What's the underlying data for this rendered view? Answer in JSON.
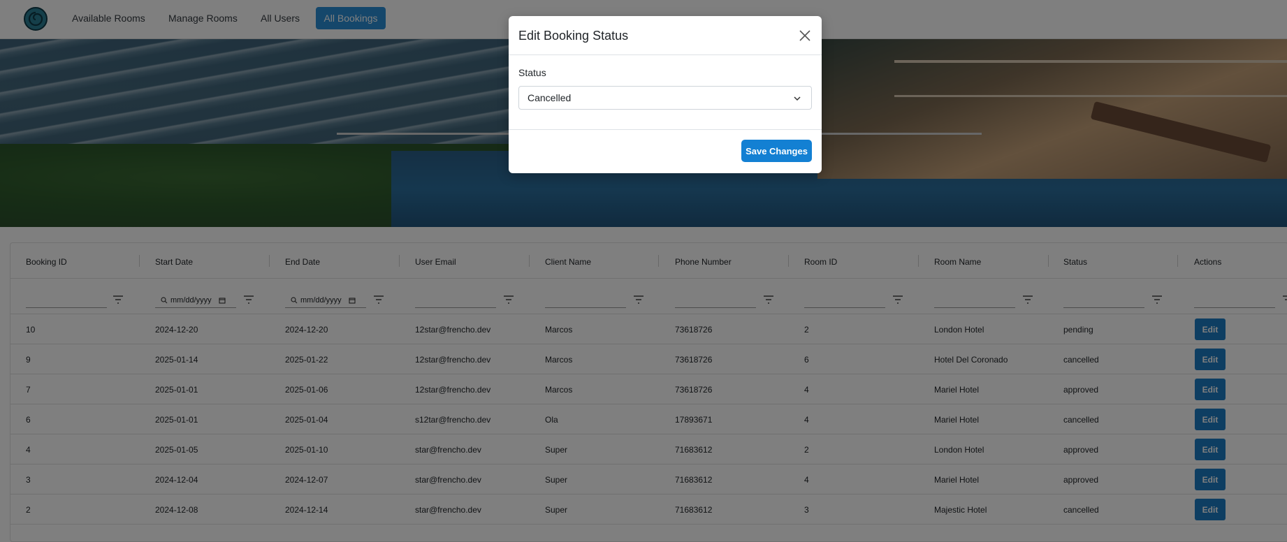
{
  "nav": {
    "items": [
      {
        "label": "Available Rooms"
      },
      {
        "label": "Manage Rooms"
      },
      {
        "label": "All Users"
      }
    ],
    "active_label": "All Bookings"
  },
  "table": {
    "columns": [
      "Booking ID",
      "Start Date",
      "End Date",
      "User Email",
      "Client Name",
      "Phone Number",
      "Room ID",
      "Room Name",
      "Status",
      "Actions"
    ],
    "date_placeholder": "mm/dd/yyyy",
    "edit_label": "Edit",
    "rows": [
      {
        "id": "10",
        "start": "2024-12-20",
        "end": "2024-12-20",
        "email": "12star@frencho.dev",
        "client": "Marcos",
        "phone": "73618726",
        "room_id": "2",
        "room_name": "London Hotel",
        "status": "pending"
      },
      {
        "id": "9",
        "start": "2025-01-14",
        "end": "2025-01-22",
        "email": "12star@frencho.dev",
        "client": "Marcos",
        "phone": "73618726",
        "room_id": "6",
        "room_name": "Hotel Del Coronado",
        "status": "cancelled"
      },
      {
        "id": "7",
        "start": "2025-01-01",
        "end": "2025-01-06",
        "email": "12star@frencho.dev",
        "client": "Marcos",
        "phone": "73618726",
        "room_id": "4",
        "room_name": "Mariel Hotel",
        "status": "approved"
      },
      {
        "id": "6",
        "start": "2025-01-01",
        "end": "2025-01-04",
        "email": "s12tar@frencho.dev",
        "client": "Ola",
        "phone": "17893671",
        "room_id": "4",
        "room_name": "Mariel Hotel",
        "status": "cancelled"
      },
      {
        "id": "4",
        "start": "2025-01-05",
        "end": "2025-01-10",
        "email": "star@frencho.dev",
        "client": "Super",
        "phone": "71683612",
        "room_id": "2",
        "room_name": "London Hotel",
        "status": "approved"
      },
      {
        "id": "3",
        "start": "2024-12-04",
        "end": "2024-12-07",
        "email": "star@frencho.dev",
        "client": "Super",
        "phone": "71683612",
        "room_id": "4",
        "room_name": "Mariel Hotel",
        "status": "approved"
      },
      {
        "id": "2",
        "start": "2024-12-08",
        "end": "2024-12-14",
        "email": "star@frencho.dev",
        "client": "Super",
        "phone": "71683612",
        "room_id": "3",
        "room_name": "Majestic Hotel",
        "status": "cancelled"
      }
    ]
  },
  "modal": {
    "title": "Edit Booking Status",
    "status_label": "Status",
    "selected_status": "Cancelled",
    "save_label": "Save Changes"
  },
  "colors": {
    "primary": "#1380d3",
    "nav_active": "#2b8fd6",
    "edit_button": "#1c7cc4"
  },
  "icons": [
    "logo-icon",
    "close-icon",
    "chevron-down-icon",
    "filter-icon",
    "search-icon",
    "calendar-icon"
  ]
}
